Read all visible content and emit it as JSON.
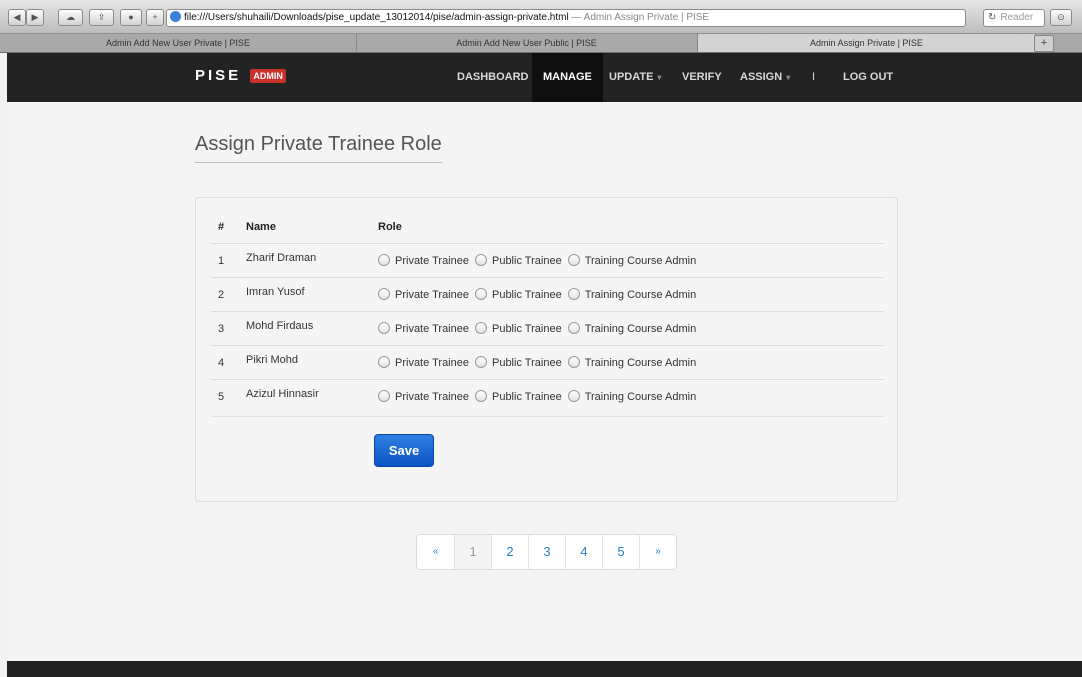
{
  "browser": {
    "url": "file:///Users/shuhaili/Downloads/pise_update_13012014/pise/admin-assign-private.html",
    "url_suffix": " — Admin Assign Private | PISE",
    "reader_label": "Reader",
    "tabs": [
      {
        "label": "Admin Add New User Private | PISE"
      },
      {
        "label": "Admin Add New User Public | PISE"
      },
      {
        "label": "Admin Assign Private | PISE"
      }
    ],
    "new_tab": "+"
  },
  "nav": {
    "brand": "PISE",
    "badge": "ADMIN",
    "items": [
      {
        "label": "DASHBOARD"
      },
      {
        "label": "MANAGE"
      },
      {
        "label": "UPDATE"
      },
      {
        "label": "VERIFY"
      },
      {
        "label": "ASSIGN"
      },
      {
        "label": "I"
      },
      {
        "label": "LOG OUT"
      }
    ],
    "caret": "▾"
  },
  "page": {
    "title": "Assign Private Trainee Role"
  },
  "table": {
    "headers": {
      "num": "#",
      "name": "Name",
      "role": "Role"
    },
    "role_options": [
      "Private Trainee",
      "Public Trainee",
      "Training Course Admin"
    ],
    "rows": [
      {
        "num": "1",
        "name": "Zharif Draman"
      },
      {
        "num": "2",
        "name": "Imran Yusof"
      },
      {
        "num": "3",
        "name": "Mohd Firdaus"
      },
      {
        "num": "4",
        "name": "Pikri Mohd"
      },
      {
        "num": "5",
        "name": "Azizul Hinnasir"
      }
    ]
  },
  "form": {
    "save_label": "Save"
  },
  "pagination": {
    "prev": "«",
    "pages": [
      "1",
      "2",
      "3",
      "4",
      "5"
    ],
    "next": "»",
    "current": "1"
  },
  "colors": {
    "navbar": "#232323",
    "badge": "#c9302c",
    "save": "#0b55c4",
    "link": "#2a7ec9"
  }
}
